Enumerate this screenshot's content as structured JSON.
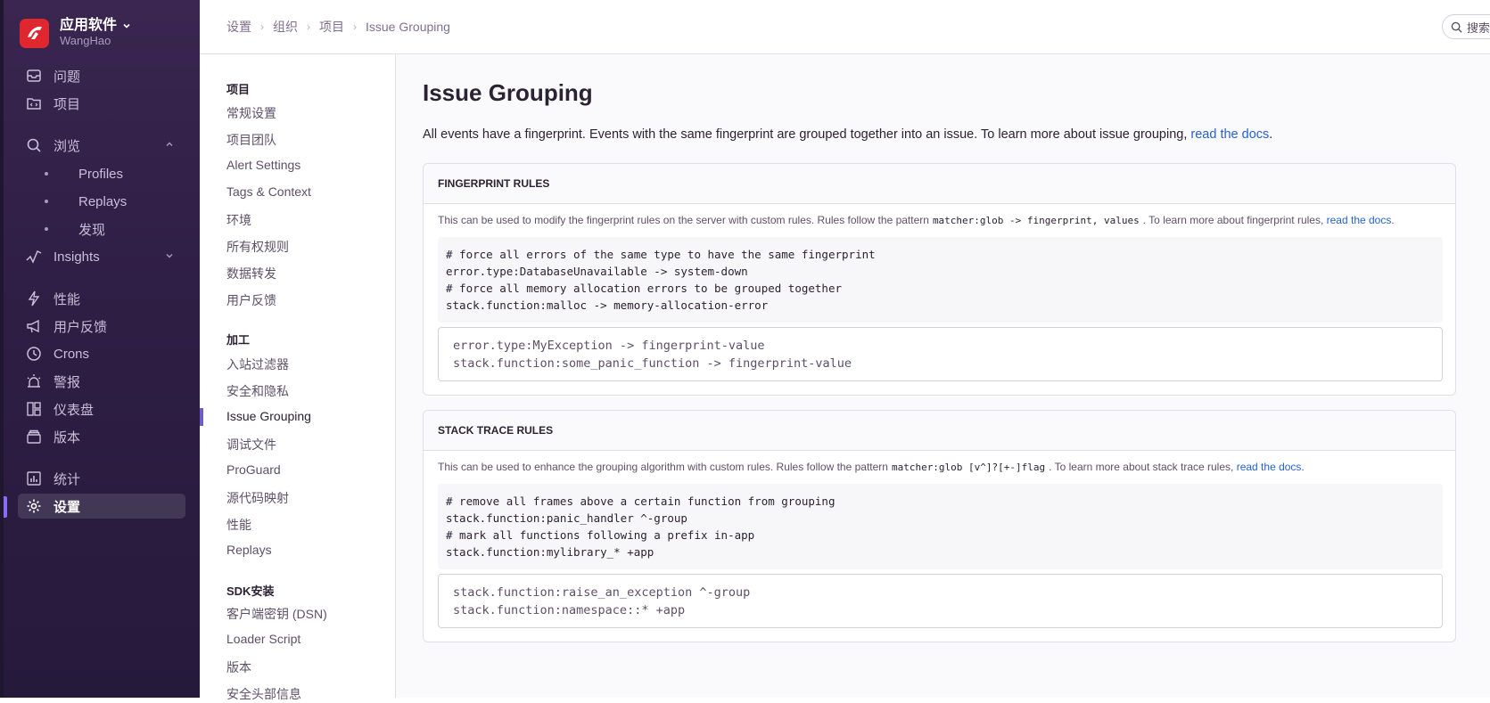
{
  "org": {
    "name": "应用软件",
    "user": "WangHao"
  },
  "nav": {
    "issues": "问题",
    "projects": "项目",
    "explore": "浏览",
    "profiles": "Profiles",
    "replays": "Replays",
    "discover": "发现",
    "insights": "Insights",
    "performance": "性能",
    "feedback": "用户反馈",
    "crons": "Crons",
    "alerts": "警报",
    "dashboards": "仪表盘",
    "releases": "版本",
    "stats": "统计",
    "settings": "设置"
  },
  "breadcrumb": [
    "设置",
    "组织",
    "项目",
    "Issue Grouping"
  ],
  "search": {
    "label": "搜索"
  },
  "settings_nav": {
    "project_heading": "项目",
    "project_items": [
      "常规设置",
      "项目团队",
      "Alert Settings",
      "Tags & Context",
      "环境",
      "所有权规则",
      "数据转发",
      "用户反馈"
    ],
    "processing_heading": "加工",
    "processing_items": [
      "入站过滤器",
      "安全和隐私",
      "Issue Grouping",
      "调试文件",
      "ProGuard",
      "源代码映射",
      "性能",
      "Replays"
    ],
    "sdk_heading": "SDK安装",
    "sdk_items": [
      "客户端密钥 (DSN)",
      "Loader Script",
      "版本",
      "安全头部信息"
    ],
    "active": "Issue Grouping"
  },
  "main": {
    "title": "Issue Grouping",
    "description": "All events have a fingerprint. Events with the same fingerprint are grouped together into an issue. To learn more about issue grouping, ",
    "description_link": "read the docs",
    "description_end": "."
  },
  "fingerprint": {
    "header": "FINGERPRINT RULES",
    "help_prefix": "This can be used to modify the fingerprint rules on the server with custom rules. Rules follow the pattern",
    "help_code": "matcher:glob -> fingerprint, values",
    "help_suffix": ". To learn more about fingerprint rules,",
    "help_link": "read the docs",
    "help_end": ".",
    "example": "# force all errors of the same type to have the same fingerprint\nerror.type:DatabaseUnavailable -> system-down\n# force all memory allocation errors to be grouped together\nstack.function:malloc -> memory-allocation-error",
    "placeholder": "error.type:MyException -> fingerprint-value\nstack.function:some_panic_function -> fingerprint-value"
  },
  "stacktrace": {
    "header": "STACK TRACE RULES",
    "help_prefix": "This can be used to enhance the grouping algorithm with custom rules. Rules follow the pattern",
    "help_code": "matcher:glob [v^]?[+-]flag",
    "help_suffix": ". To learn more about stack trace rules,",
    "help_link": "read the docs",
    "help_end": ".",
    "example": "# remove all frames above a certain function from grouping\nstack.function:panic_handler ^-group\n# mark all functions following a prefix in-app\nstack.function:mylibrary_* +app",
    "placeholder": "stack.function:raise_an_exception ^-group\nstack.function:namespace::* +app"
  },
  "colors": {
    "sidebar": "#2f1e45",
    "accent": "#6c5fc7",
    "link": "#2562d4",
    "logo": "#e0262f"
  }
}
